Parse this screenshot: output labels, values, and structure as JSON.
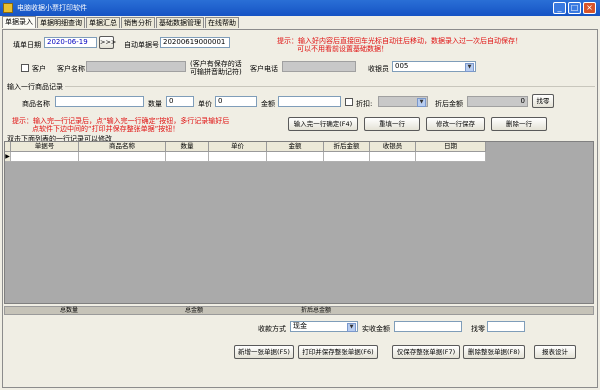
{
  "window": {
    "title": "电脑收据小票打印软件"
  },
  "tabs": [
    "单据录入",
    "单据明细查询",
    "单据汇总",
    "销售分析",
    "基础数据管理",
    "在线帮助"
  ],
  "form": {
    "date_label": "填单日期",
    "date_value": "2020-06-19",
    "date_btn": ">>>",
    "auto_no_label": "自动单据号",
    "auto_no_value": "20200619000001",
    "hint1": "提示：输入好内容后直接回车光标自动往后移动，数据录入过一次后自动保存！",
    "hint2": "可以不用看前设置基础数据！",
    "customer_check": "客户",
    "customer_name_label": "客户名称",
    "customer_note1": "(客户有保存的话",
    "customer_note2": "可输拼音助记符)",
    "customer_phone_label": "客户电话",
    "cashier_label": "收银员",
    "cashier_value": "005"
  },
  "item": {
    "section_title": "输入一行商品记录",
    "name_label": "商品名称",
    "qty_label": "数量",
    "qty_value": "0",
    "price_label": "单价",
    "price_value": "0",
    "amount_label": "金额",
    "discount_label": "折扣:",
    "disc_amount_label": "折后金额",
    "disc_amount_value": "0",
    "change_btn": "找零",
    "hint1": "提示：输入完一行记录后，点“输入完一行确定”按钮，多行记录输好后",
    "hint2": "点软件下边中间的“打印并保存整张单据”按钮！",
    "btn_confirm": "输入完一行确定(F4)",
    "btn_rewrite": "重填一行",
    "btn_modify": "修改一行保存",
    "btn_delete": "删除一行",
    "grid_hint": "双击下面列表的一行记录可以修改"
  },
  "grid": {
    "columns": [
      "单据号",
      "商品名称",
      "数量",
      "单价",
      "金额",
      "折后金额",
      "收银员",
      "日期"
    ],
    "row_marker": "▶"
  },
  "totals": {
    "total_qty": "总数量",
    "total_amount": "总金额",
    "total_disc": "折后总金额"
  },
  "payment": {
    "method_label": "收款方式",
    "method_value": "现金",
    "received_label": "实收金额",
    "change_label": "找零"
  },
  "actions": {
    "new": "新增一张单据(F5)",
    "print_save": "打印并保存整张单据(F6)",
    "save_only": "仅保存整张单据(F7)",
    "delete": "删除整张单据(F8)",
    "report": "报表设计"
  }
}
